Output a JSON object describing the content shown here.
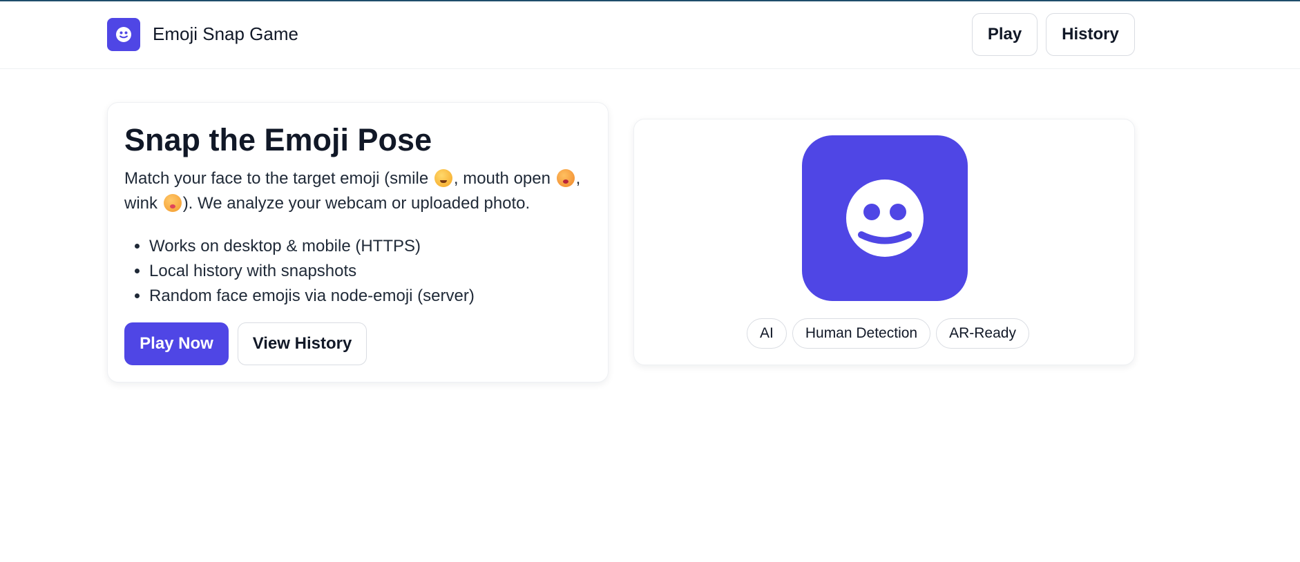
{
  "header": {
    "logo_icon": "smiley-face-icon",
    "title": "Emoji Snap Game",
    "nav": [
      {
        "label": "Play"
      },
      {
        "label": "History"
      }
    ]
  },
  "hero": {
    "title": "Snap the Emoji Pose",
    "description": {
      "part1": "Match your face to the target emoji (smile ",
      "part2": ", mouth open ",
      "part3": ", wink ",
      "part4": "). We analyze your webcam or uploaded photo."
    },
    "features": [
      "Works on desktop & mobile (HTTPS)",
      "Local history with snapshots",
      "Random face emojis via node-emoji (server)"
    ],
    "primary_button": "Play Now",
    "secondary_button": "View History"
  },
  "showcase": {
    "logo_icon": "smiley-face-icon",
    "tags": [
      "AI",
      "Human Detection",
      "AR-Ready"
    ]
  },
  "colors": {
    "accent": "#4f46e5",
    "text": "#111827",
    "border": "#d9dce2"
  }
}
